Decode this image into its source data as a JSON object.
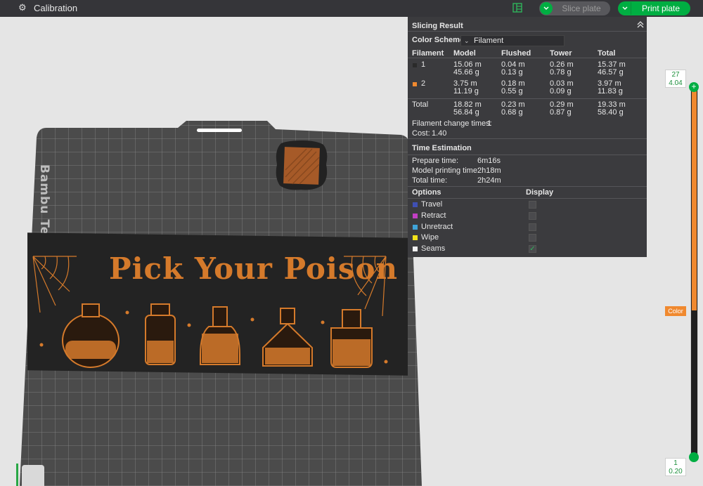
{
  "topbar": {
    "icon": "gear-icon",
    "title": "Calibration",
    "layout_icon": "panel-layout-icon",
    "slice_label": "Slice plate",
    "print_label": "Print plate"
  },
  "plate": {
    "side_label": "Bambu Textured",
    "banner_title": "Pick Your Poison"
  },
  "slicing_result": {
    "title": "Slicing Result",
    "color_scheme_label": "Color Scheme",
    "color_scheme_value": "Filament",
    "headers": [
      "Filament",
      "Model",
      "Flushed",
      "Tower",
      "Total"
    ],
    "rows": [
      {
        "filament": "1",
        "color": "#2a2a2a",
        "model": [
          "15.06 m",
          "45.66 g"
        ],
        "flushed": [
          "0.04 m",
          "0.13 g"
        ],
        "tower": [
          "0.26 m",
          "0.78 g"
        ],
        "total": [
          "15.37 m",
          "46.57 g"
        ]
      },
      {
        "filament": "2",
        "color": "#f0892f",
        "model": [
          "3.75 m",
          "11.19 g"
        ],
        "flushed": [
          "0.18 m",
          "0.55 g"
        ],
        "tower": [
          "0.03 m",
          "0.09 g"
        ],
        "total": [
          "3.97 m",
          "11.83 g"
        ]
      }
    ],
    "total_row": {
      "label": "Total",
      "model": [
        "18.82 m",
        "56.84 g"
      ],
      "flushed": [
        "0.23 m",
        "0.68 g"
      ],
      "tower": [
        "0.29 m",
        "0.87 g"
      ],
      "total": [
        "19.33 m",
        "58.40 g"
      ]
    },
    "change_times_label": "Filament change times:",
    "change_times_value": "1",
    "cost_label": "Cost:",
    "cost_value": "1.40"
  },
  "time_estimation": {
    "title": "Time Estimation",
    "rows": [
      {
        "label": "Prepare time:",
        "value": "6m16s"
      },
      {
        "label": "Model printing time:",
        "value": "2h18m"
      },
      {
        "label": "Total time:",
        "value": "2h24m"
      }
    ]
  },
  "options": {
    "header_options": "Options",
    "header_display": "Display",
    "items": [
      {
        "label": "Travel",
        "color": "#3f4fb4",
        "checked": false
      },
      {
        "label": "Retract",
        "color": "#c23fc4",
        "checked": false
      },
      {
        "label": "Unretract",
        "color": "#3fa3d8",
        "checked": false
      },
      {
        "label": "Wipe",
        "color": "#f2e21a",
        "checked": false
      },
      {
        "label": "Seams",
        "color": "#f0f0f0",
        "checked": true
      }
    ]
  },
  "layer_slider": {
    "top_layer": "27",
    "top_height": "4.04",
    "bottom_layer": "1",
    "bottom_height": "0.20",
    "color_tag": "Color",
    "top_color": "#f0892f",
    "bottom_color": "#1f1f1f"
  }
}
